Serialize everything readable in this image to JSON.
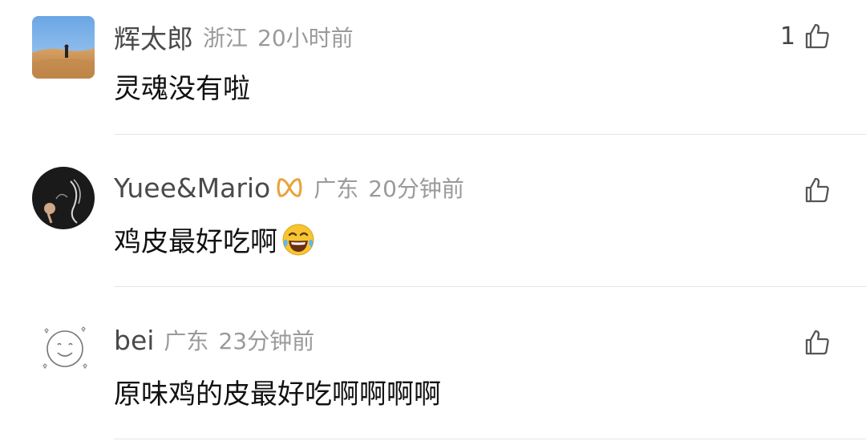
{
  "comments": [
    {
      "username": "辉太郎",
      "location": "浙江",
      "time": "20小时前",
      "content": "灵魂没有啦",
      "likes": "1",
      "avatar_icon": "desert-photo-avatar"
    },
    {
      "username": "Yuee&Mario",
      "location": "广东",
      "time": "20分钟前",
      "content": "鸡皮最好吃啊",
      "likes": "",
      "avatar_icon": "dark-illustration-avatar",
      "badge_icon": "infinity-badge-icon",
      "emoji": "laughing-tears-emoji"
    },
    {
      "username": "bei",
      "location": "广东",
      "time": "23分钟前",
      "content": "原味鸡的皮最好吃啊啊啊啊",
      "likes": "",
      "avatar_icon": "smiley-face-avatar"
    }
  ],
  "colors": {
    "username": "#4a4a4a",
    "meta": "#9a9a9a",
    "content": "#111111",
    "divider": "#e5e5e5",
    "badge": "#e8a33a"
  }
}
